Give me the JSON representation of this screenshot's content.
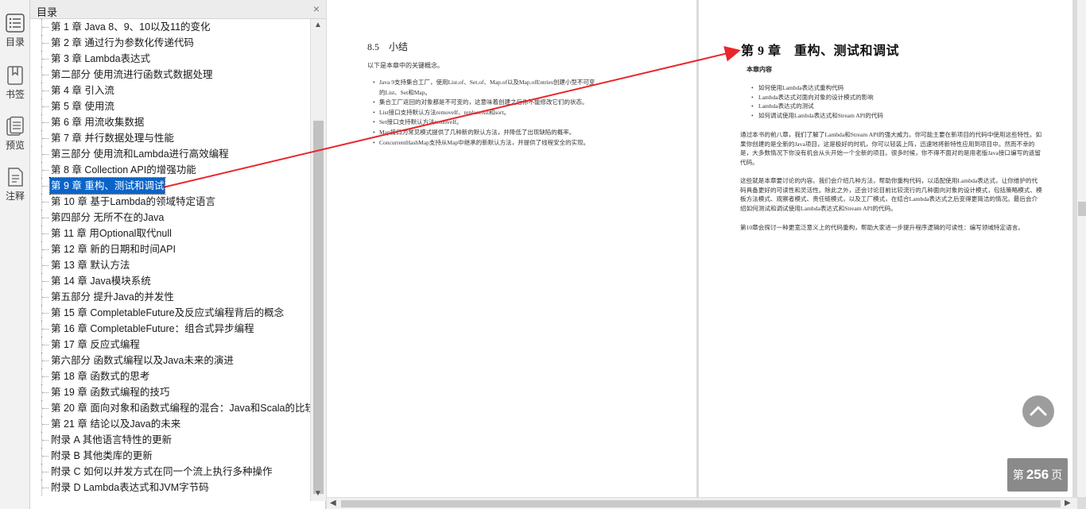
{
  "rail": {
    "items": [
      {
        "label": "目录",
        "icon": "toc-icon"
      },
      {
        "label": "书签",
        "icon": "bookmark-icon"
      },
      {
        "label": "预览",
        "icon": "preview-icon"
      },
      {
        "label": "注释",
        "icon": "annotation-icon"
      }
    ]
  },
  "toc": {
    "title": "目录",
    "close": "×",
    "items": [
      "第 1 章 Java 8、9、10以及11的变化",
      "第 2 章 通过行为参数化传递代码",
      "第 3 章 Lambda表达式",
      "第二部分 使用流进行函数式数据处理",
      "第 4 章 引入流",
      "第 5 章 使用流",
      "第 6 章 用流收集数据",
      "第 7 章 并行数据处理与性能",
      "第三部分 使用流和Lambda进行高效编程",
      "第 8 章 Collection API的增强功能",
      "第 9 章 重构、测试和调试",
      "第 10 章 基于Lambda的领域特定语言",
      "第四部分 无所不在的Java",
      "第 11 章 用Optional取代null",
      "第 12 章 新的日期和时间API",
      "第 13 章 默认方法",
      "第 14 章 Java模块系统",
      "第五部分 提升Java的并发性",
      "第 15 章 CompletableFuture及反应式编程背后的概念",
      "第 16 章 CompletableFuture：组合式异步编程",
      "第 17 章 反应式编程",
      "第六部分 函数式编程以及Java未来的演进",
      "第 18 章 函数式的思考",
      "第 19 章 函数式编程的技巧",
      "第 20 章 面向对象和函数式编程的混合：Java和Scala的比较",
      "第 21 章 结论以及Java的未来",
      "附录 A 其他语言特性的更新",
      "附录 B 其他类库的更新",
      "附录 C 如何以并发方式在同一个流上执行多种操作",
      "附录 D Lambda表达式和JVM字节码"
    ],
    "selected_index": 10
  },
  "left_page": {
    "section_heading": "8.5　小结",
    "intro": "以下是本章中的关键概念。",
    "bullets": [
      "Java 9支持集合工厂，使用List.of、Set.of、Map.of以及Map.ofEntries创建小型不可变",
      "的List、Set和Map。",
      "集合工厂返回的对象都是不可变的，这意味着创建之后你不能修改它们的状态。",
      "List接口支持默认方法removeIf、replaceAll和sort。",
      "Set接口支持默认方法removeIf。",
      "Map接口为常见模式提供了几种新的默认方法，并降低了出现缺陷的概率。",
      "ConcurrentHashMap支持从Map中继承的新默认方法，并提供了线程安全的实现。"
    ]
  },
  "right_page": {
    "chapter_title": "第 9 章　重构、测试和调试",
    "subtitle": "本章内容",
    "bullets": [
      "如何使用Lambda表达式重构代码",
      "Lambda表达式对面向对象的设计模式的影响",
      "Lambda表达式的测试",
      "如何调试使用Lambda表达式和Stream API的代码"
    ],
    "paragraphs": [
      "通过本书的前八章，我们了解了Lambda和Stream API的强大威力。你可能主要在新项目的代码中使用这些特性。如果你创建的是全新的Java项目，这是极好的时机，你可以轻装上阵，迅速地将新特性应用到项目中。然而不幸的是，大多数情况下你没有机会从头开始一个全新的项目。很多时候，你不得不面对的是用老版Java接口编写的遗留代码。",
      "这些就是本章要讨论的内容。我们会介绍几种方法，帮助你重构代码，以适配使用Lambda表达式，让你维护的代码具备更好的可读性和灵活性。除此之外，还会讨论目前比较流行的几种面向对象的设计模式，包括策略模式、模板方法模式、观察者模式、责任链模式，以及工厂模式，在结合Lambda表达式之后变得更简洁的情况。最后会介绍如何测试和调试使用Lambda表达式和Stream API的代码。",
      "第10章会探讨一种更宽泛意义上的代码重构，帮助大家进一步提升程序逻辑的可读性：编写领域特定语言。"
    ]
  },
  "page_indicator": {
    "prefix": "第",
    "number": "256",
    "suffix": "页"
  },
  "colors": {
    "selection": "#0a64c8",
    "arrow": "#e8262b",
    "badge": "#8a8a8a"
  }
}
